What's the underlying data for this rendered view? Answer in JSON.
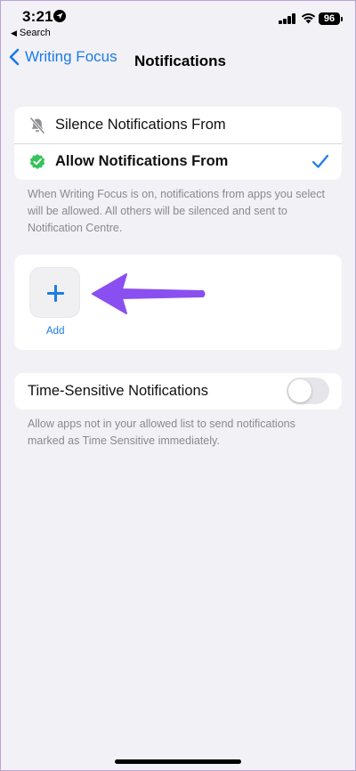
{
  "status_bar": {
    "time": "3:21",
    "back_app": "Search",
    "battery": "96"
  },
  "nav": {
    "back_label": "Writing Focus",
    "title": "Notifications"
  },
  "mode_options": {
    "silence_label": "Silence Notifications From",
    "allow_label": "Allow Notifications From",
    "selected": "allow"
  },
  "mode_footnote": "When Writing Focus is on, notifications from apps you select will be allowed. All others will be silenced and sent to Notification Centre.",
  "apps": {
    "add_label": "Add"
  },
  "time_sensitive": {
    "label": "Time-Sensitive Notifications",
    "enabled": false,
    "footnote": "Allow apps not in your allowed list to send notifications marked as Time Sensitive immediately."
  },
  "colors": {
    "accent": "#1a7ce8",
    "arrow": "#8a4ff0",
    "check_badge": "#33c35a",
    "background": "#f2f1f6"
  }
}
